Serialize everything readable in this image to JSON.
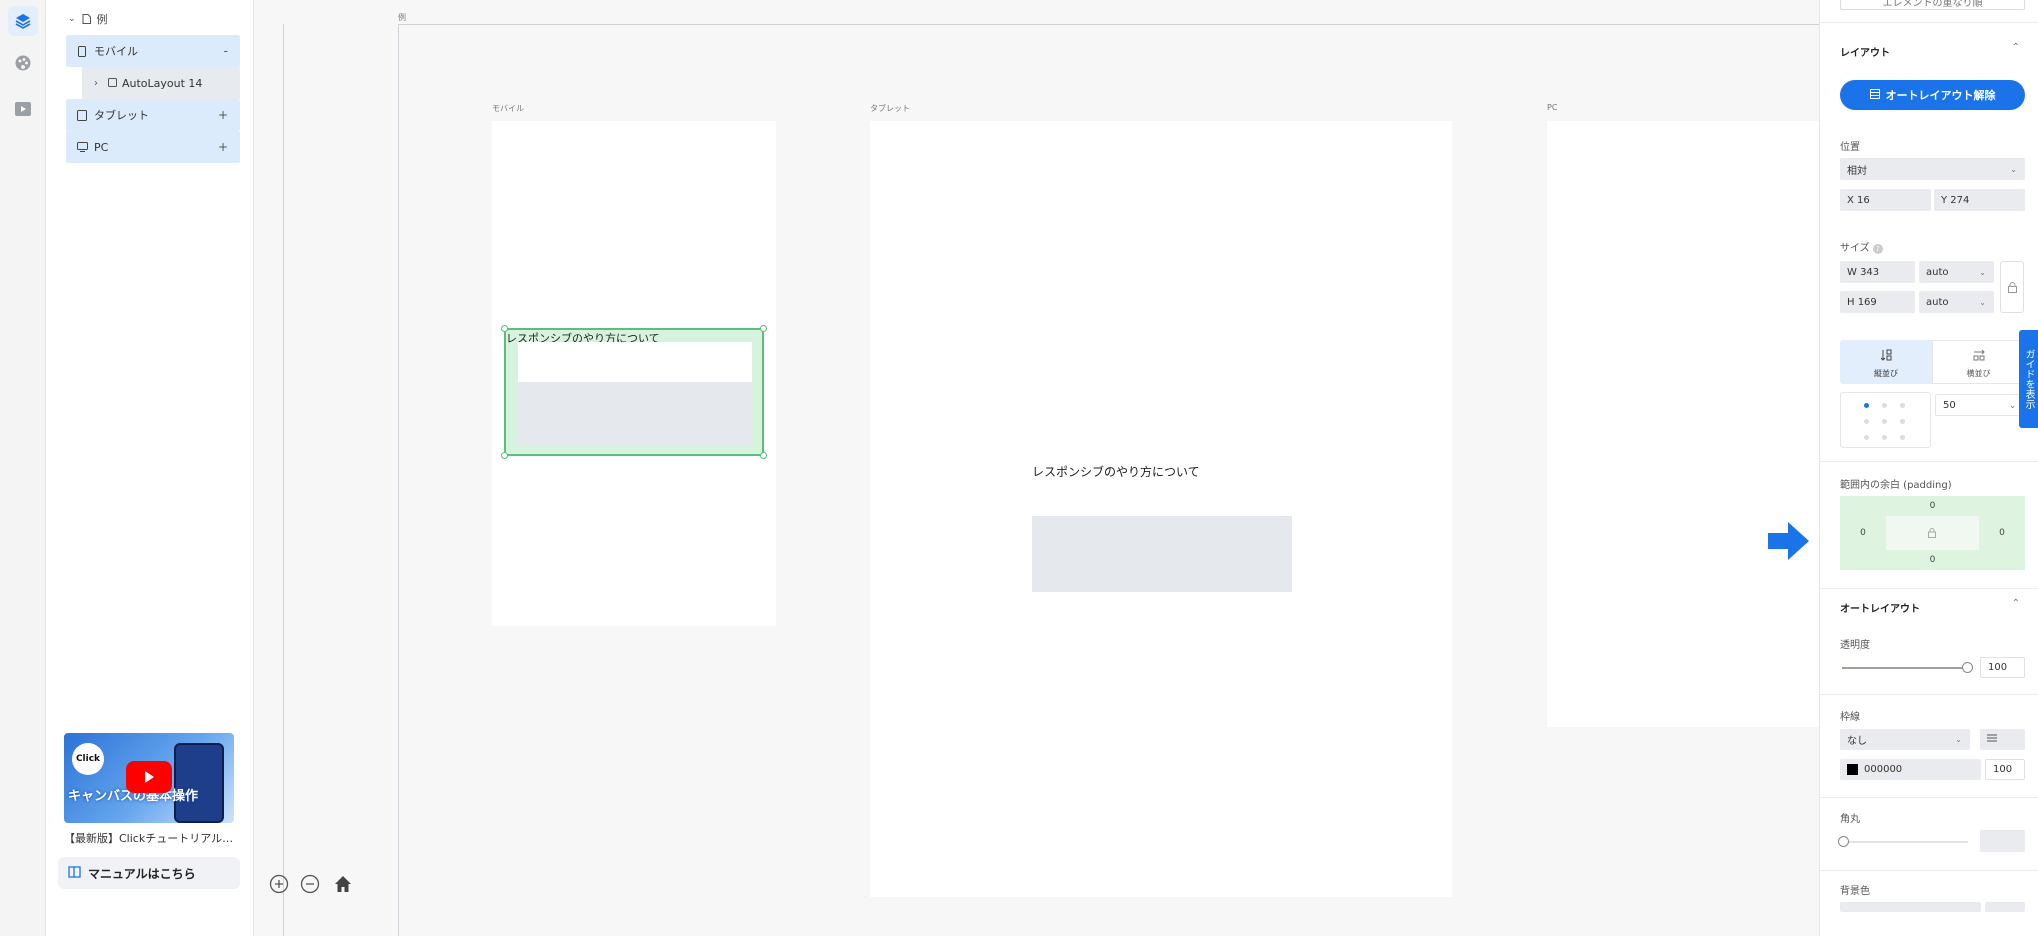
{
  "layers": {
    "root_label": "例",
    "items": [
      {
        "label": "モバイル",
        "toggle": "-"
      },
      {
        "label": "タブレット",
        "toggle": "+"
      },
      {
        "label": "PC",
        "toggle": "+"
      }
    ],
    "child_label": "AutoLayout 14",
    "video_title": "【最新版】Clickチュートリアル…",
    "video_thumb_text": "キャンバスの基本操作",
    "manual_label": "マニュアルはこちら"
  },
  "canvas": {
    "page_label": "例",
    "frames": {
      "mobile_label": "モバイル",
      "tablet_label": "タブレット",
      "pc_label": "PC"
    },
    "text_mobile": "レスポンシブのやり方について",
    "text_tablet": "レスポンシブのやり方について"
  },
  "props": {
    "top_button": "エレメントの重なり順",
    "layout_title": "レイアウト",
    "remove_autolayout": "オートレイアウト解除",
    "position_label": "位置",
    "position_value": "相対",
    "x_value": "X  16",
    "y_value": "Y  274",
    "size_label": "サイズ",
    "w_value": "W  343",
    "h_value": "H  169",
    "w_mode": "auto",
    "h_mode": "auto",
    "vertical_label": "縦並び",
    "horizontal_label": "横並び",
    "gap_value": "50",
    "padding_label": "範囲内の余白 (padding)",
    "padding": {
      "top": "0",
      "left": "0",
      "right": "0",
      "bottom": "0"
    },
    "autolayout_title": "オートレイアウト",
    "opacity_label": "透明度",
    "opacity_value": "100",
    "opacity_level": 1.0,
    "border_label": "枠線",
    "border_value": "なし",
    "border_color": "000000",
    "border_opacity": "100",
    "radius_label": "角丸",
    "bg_label": "背景色",
    "guide_tab": "ガイドを表示"
  },
  "colors": {
    "accent": "#1a73e8",
    "selection": "#58c07a",
    "selection_fill": "#d7f3dd",
    "placeholder": "#e5e8ec"
  }
}
